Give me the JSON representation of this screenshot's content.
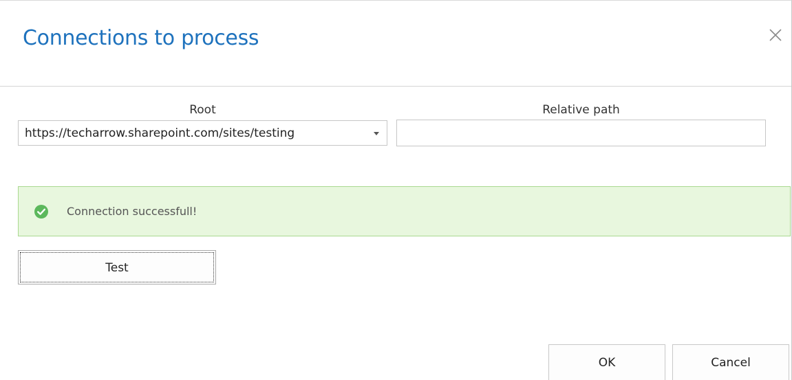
{
  "dialog": {
    "title": "Connections to process",
    "close_icon": "close-icon"
  },
  "form": {
    "root": {
      "label": "Root",
      "selected_value": "https://techarrow.sharepoint.com/sites/testing",
      "caret_icon": "chevron-down-icon"
    },
    "relative_path": {
      "label": "Relative path",
      "value": "",
      "placeholder": ""
    }
  },
  "status": {
    "icon": "check-circle-icon",
    "message": "Connection successfull!",
    "colors": {
      "background": "#e8f7de",
      "border": "#a9d88f",
      "icon": "#5cb85c"
    }
  },
  "actions": {
    "test_label": "Test",
    "ok_label": "OK",
    "cancel_label": "Cancel"
  },
  "colors": {
    "title": "#1e72bd"
  }
}
